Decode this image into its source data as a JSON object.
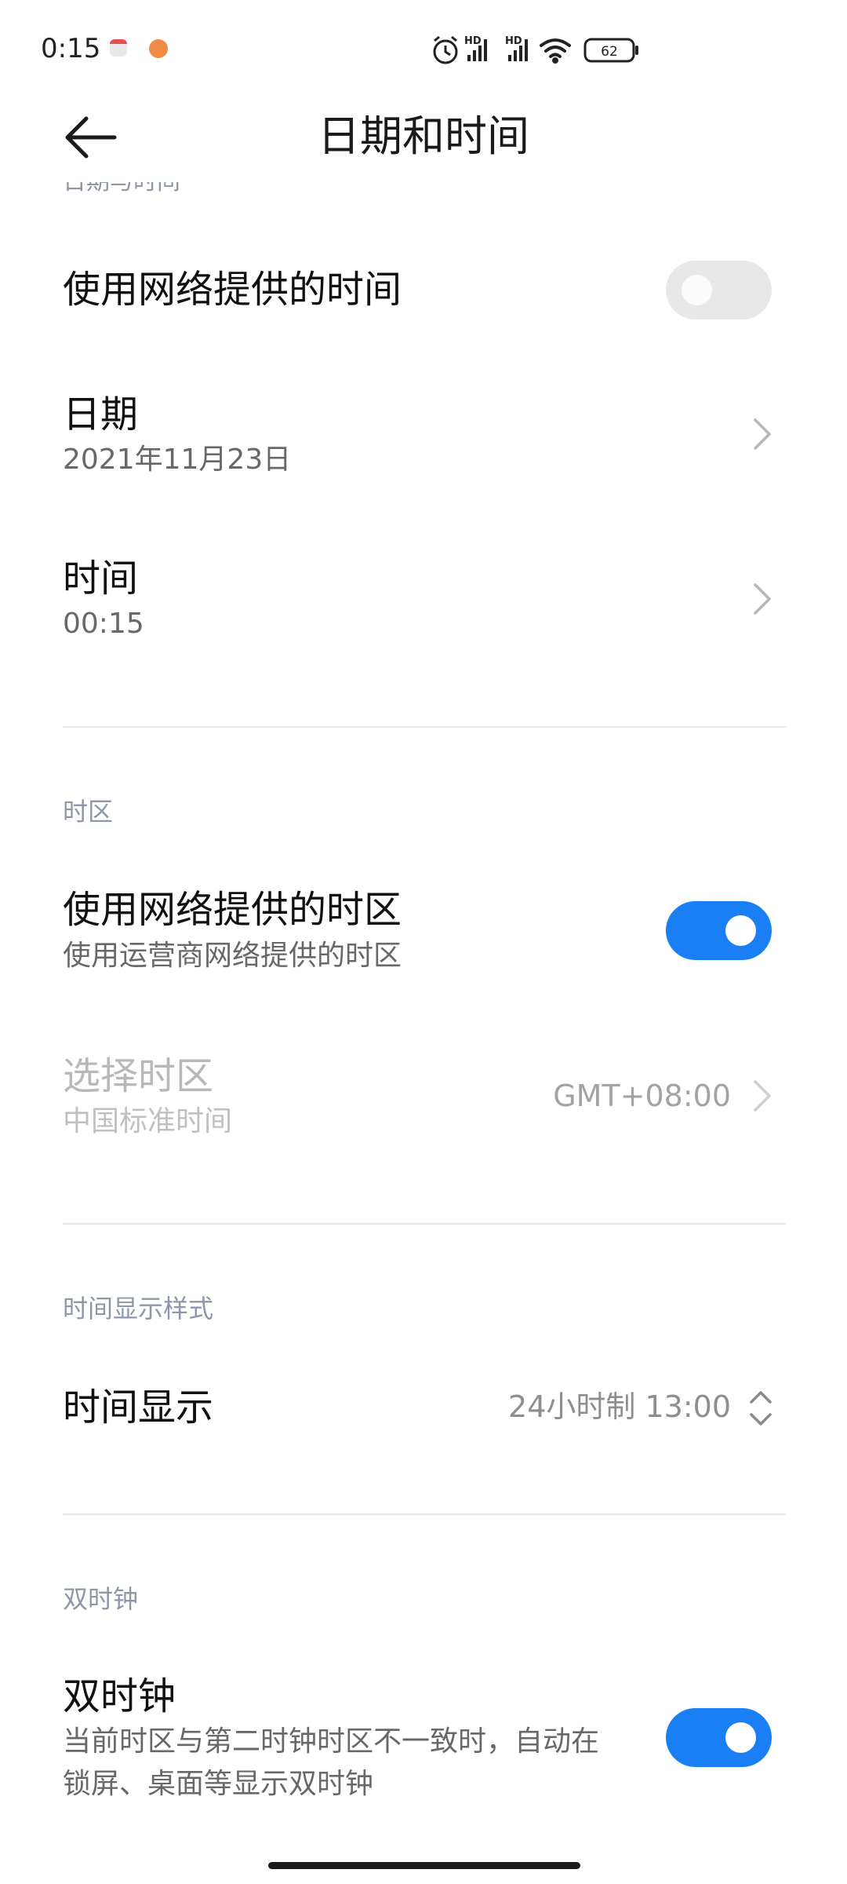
{
  "status_bar": {
    "time": "0:15",
    "battery": "62",
    "hd_label": "HD"
  },
  "header": {
    "title": "日期和时间"
  },
  "date_time_section": {
    "label_cut": "日期与时间",
    "network_time": {
      "title": "使用网络提供的时间",
      "enabled": false
    },
    "date": {
      "title": "日期",
      "value": "2021年11月23日"
    },
    "time": {
      "title": "时间",
      "value": "00:15"
    }
  },
  "timezone_section": {
    "label": "时区",
    "network_timezone": {
      "title": "使用网络提供的时区",
      "subtitle": "使用运营商网络提供的时区",
      "enabled": true
    },
    "select_timezone": {
      "title": "选择时区",
      "subtitle": "中国标准时间",
      "value": "GMT+08:00"
    }
  },
  "display_section": {
    "label": "时间显示样式",
    "time_format": {
      "title": "时间显示",
      "value": "24小时制 13:00"
    }
  },
  "dual_clock_section": {
    "label": "双时钟",
    "dual_clock": {
      "title": "双时钟",
      "subtitle_line1": "当前时区与第二时钟时区不一致时，自动在",
      "subtitle_line2": "锁屏、桌面等显示双时钟",
      "enabled": true
    }
  },
  "colors": {
    "accent": "#1a7ff5",
    "section_label": "#8d97a8",
    "toggle_off": "#e8e8e8"
  },
  "icons": [
    "back-arrow-icon",
    "chevron-right-icon",
    "up-down-chevron-icon",
    "alarm-icon",
    "signal-icon",
    "wifi-icon",
    "battery-icon"
  ]
}
